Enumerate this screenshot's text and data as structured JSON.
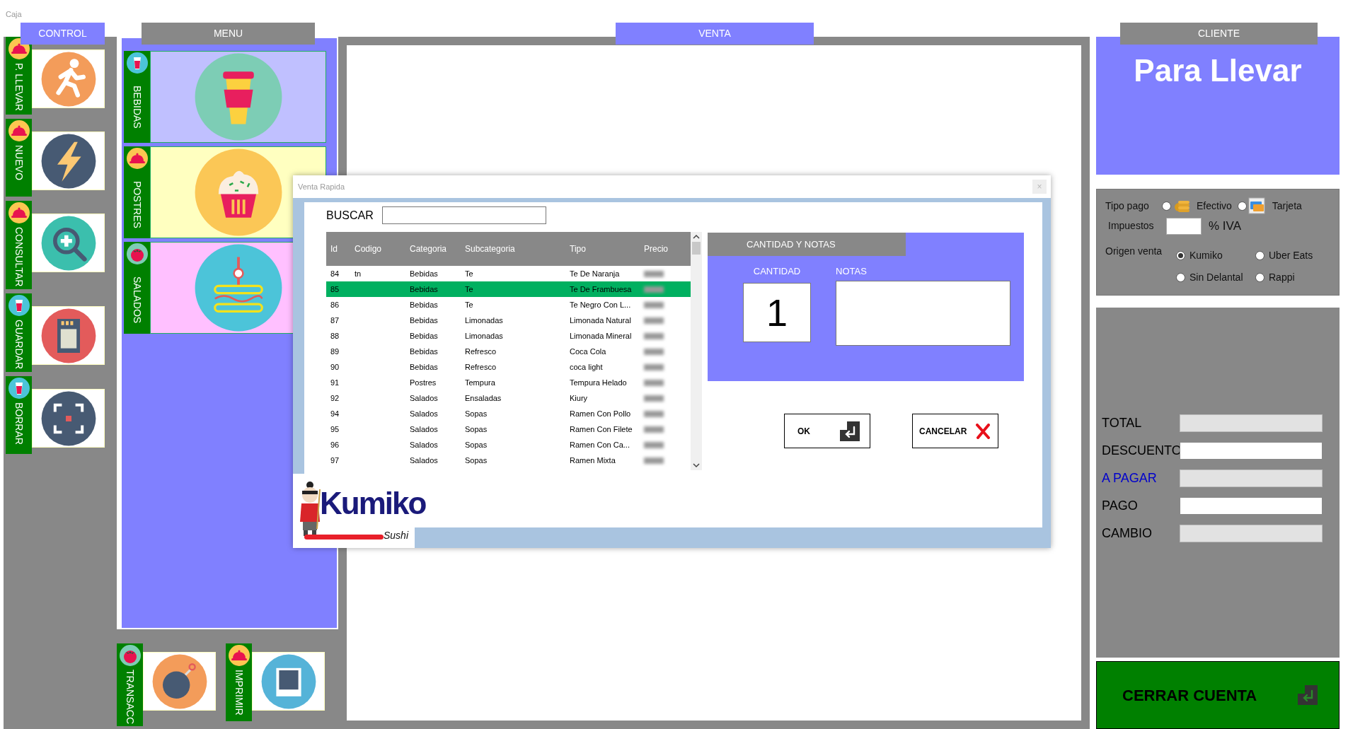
{
  "window": {
    "title": "Caja"
  },
  "control": {
    "title": "CONTROL",
    "items": [
      {
        "label": "P. LLEVAR"
      },
      {
        "label": "NUEVO"
      },
      {
        "label": "CONSULTAR"
      },
      {
        "label": "GUARDAR"
      },
      {
        "label": "BORRAR"
      }
    ]
  },
  "menu": {
    "title": "MENU",
    "items": [
      {
        "label": "BEBIDAS",
        "color": "#c0c0ff"
      },
      {
        "label": "POSTRES",
        "color": "#ffffc0"
      },
      {
        "label": "SALADOS",
        "color": "#ffc0ff"
      }
    ]
  },
  "actions": [
    {
      "label": "TRANSACC"
    },
    {
      "label": "IMPRIMIR"
    }
  ],
  "venta": {
    "title": "VENTA"
  },
  "cliente": {
    "title": "CLIENTE",
    "name": "Para Llevar"
  },
  "payment": {
    "tipo_label": "Tipo pago",
    "tipo_options": [
      {
        "label": "Efectivo",
        "selected": false
      },
      {
        "label": "Tarjeta",
        "selected": false
      }
    ],
    "tax_label": "Impuestos",
    "tax_suffix": "% IVA",
    "origin_label": "Origen venta",
    "origin_options": [
      {
        "label": "Kumiko",
        "selected": true
      },
      {
        "label": "Uber Eats",
        "selected": false
      },
      {
        "label": "Sin Delantal",
        "selected": false
      },
      {
        "label": "Rappi",
        "selected": false
      }
    ]
  },
  "totals": [
    {
      "label": "TOTAL",
      "color": "#000000",
      "disabled": true
    },
    {
      "label": "DESCUENTO",
      "color": "#000000",
      "disabled": false
    },
    {
      "label": "A PAGAR",
      "color": "#0000cc",
      "disabled": true
    },
    {
      "label": "PAGO",
      "color": "#000000",
      "disabled": false
    },
    {
      "label": "CAMBIO",
      "color": "#000000",
      "disabled": true
    }
  ],
  "close_button": {
    "label": "CERRAR CUENTA"
  },
  "dialog": {
    "title": "Venta Rapida",
    "close": "×",
    "search_label": "BUSCAR",
    "table": {
      "columns": [
        "Id",
        "Codigo",
        "Categoria",
        "Subcategoria",
        "Tipo",
        "Precio"
      ],
      "rows": [
        {
          "id": "84",
          "codigo": "tn",
          "categoria": "Bebidas",
          "subcategoria": "Te",
          "tipo": "Te De Naranja",
          "selected": false
        },
        {
          "id": "85",
          "categoria": "Bebidas",
          "subcategoria": "Te",
          "tipo": "Te De Frambuesa",
          "selected": true
        },
        {
          "id": "86",
          "categoria": "Bebidas",
          "subcategoria": "Te",
          "tipo": "Te Negro Con L...",
          "selected": false
        },
        {
          "id": "87",
          "categoria": "Bebidas",
          "subcategoria": "Limonadas",
          "tipo": "Limonada Natural",
          "selected": false
        },
        {
          "id": "88",
          "categoria": "Bebidas",
          "subcategoria": "Limonadas",
          "tipo": "Limonada Mineral",
          "selected": false
        },
        {
          "id": "89",
          "categoria": "Bebidas",
          "subcategoria": "Refresco",
          "tipo": "Coca Cola",
          "selected": false
        },
        {
          "id": "90",
          "categoria": "Bebidas",
          "subcategoria": "Refresco",
          "tipo": "coca light",
          "selected": false
        },
        {
          "id": "91",
          "categoria": "Postres",
          "subcategoria": "Tempura",
          "tipo": "Tempura Helado",
          "selected": false
        },
        {
          "id": "92",
          "categoria": "Salados",
          "subcategoria": "Ensaladas",
          "tipo": "Kiury",
          "selected": false
        },
        {
          "id": "94",
          "categoria": "Salados",
          "subcategoria": "Sopas",
          "tipo": "Ramen Con Pollo",
          "selected": false
        },
        {
          "id": "95",
          "categoria": "Salados",
          "subcategoria": "Sopas",
          "tipo": "Ramen Con Filete",
          "selected": false
        },
        {
          "id": "96",
          "categoria": "Salados",
          "subcategoria": "Sopas",
          "tipo": "Ramen Con Ca...",
          "selected": false
        },
        {
          "id": "97",
          "categoria": "Salados",
          "subcategoria": "Sopas",
          "tipo": "Ramen Mixta",
          "selected": false
        }
      ]
    },
    "notes_panel": {
      "title": "CANTIDAD Y NOTAS",
      "quantity_label": "CANTIDAD",
      "quantity": "1",
      "notes_label": "NOTAS"
    },
    "buttons": [
      {
        "label": "OK",
        "kind": "ok"
      },
      {
        "label": "CANCELAR",
        "kind": "cancel"
      }
    ],
    "logo": {
      "name": "Kumiko",
      "tagline": "Sushi"
    }
  }
}
